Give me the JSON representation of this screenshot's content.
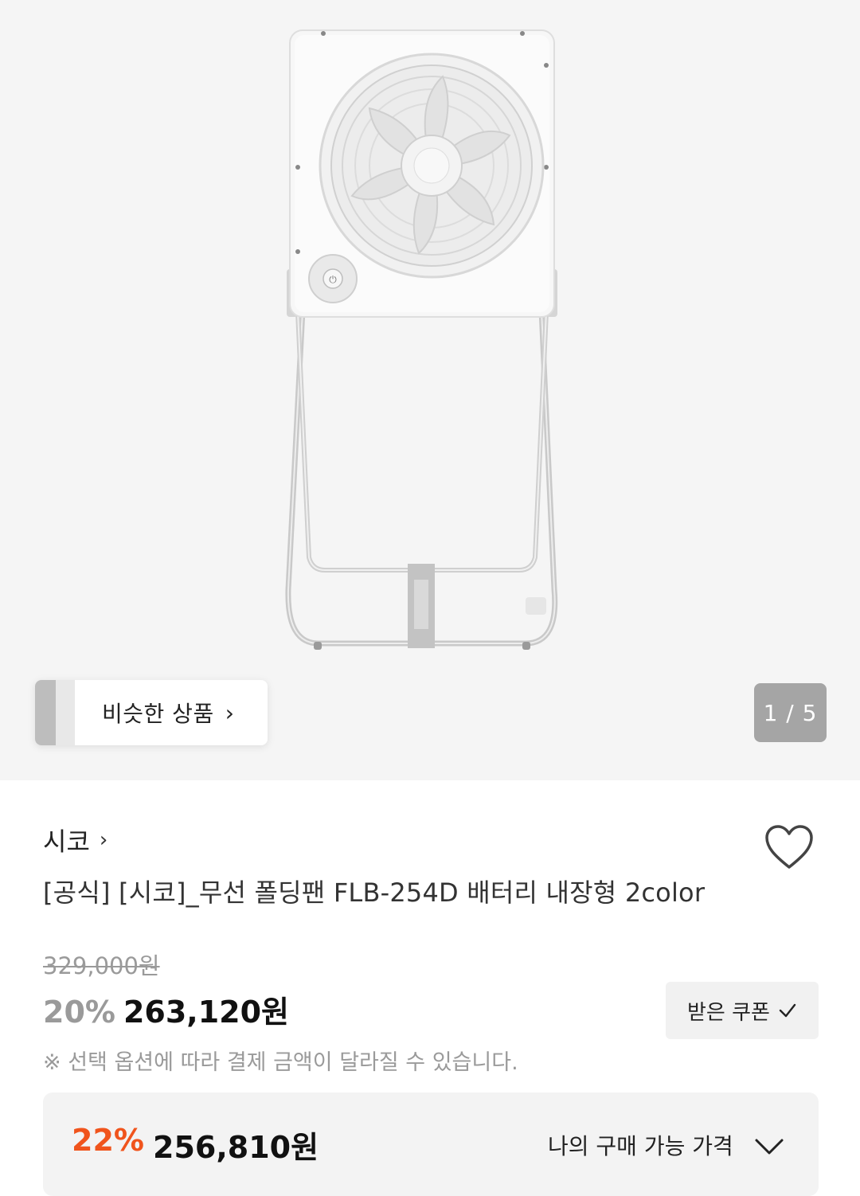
{
  "gallery": {
    "similar_label": "비슷한 상품",
    "counter": "1 / 5"
  },
  "product": {
    "brand": "시코",
    "title": "[공식] [시코]_무선 폴딩팬 FLB-254D 배터리 내장형 2color",
    "original_price": "329,000원",
    "discount_rate": "20%",
    "sale_price": "263,120원",
    "notice": "※ 선택 옵션에 따라 결제 금액이 달라질 수 있습니다."
  },
  "coupon": {
    "label": "받은 쿠폰"
  },
  "my_price": {
    "rate": "22%",
    "price": "256,810원",
    "label": "나의 구매 가능 가격"
  },
  "colors": {
    "accent": "#f0541c",
    "muted": "#9a9a9a",
    "counter_bg": "#a5a5a5"
  },
  "icons": {
    "similar": "chevron-right-icon",
    "brand": "chevron-right-icon",
    "wishlist": "heart-outline-icon",
    "coupon": "check-icon",
    "my_price": "chevron-down-icon"
  }
}
